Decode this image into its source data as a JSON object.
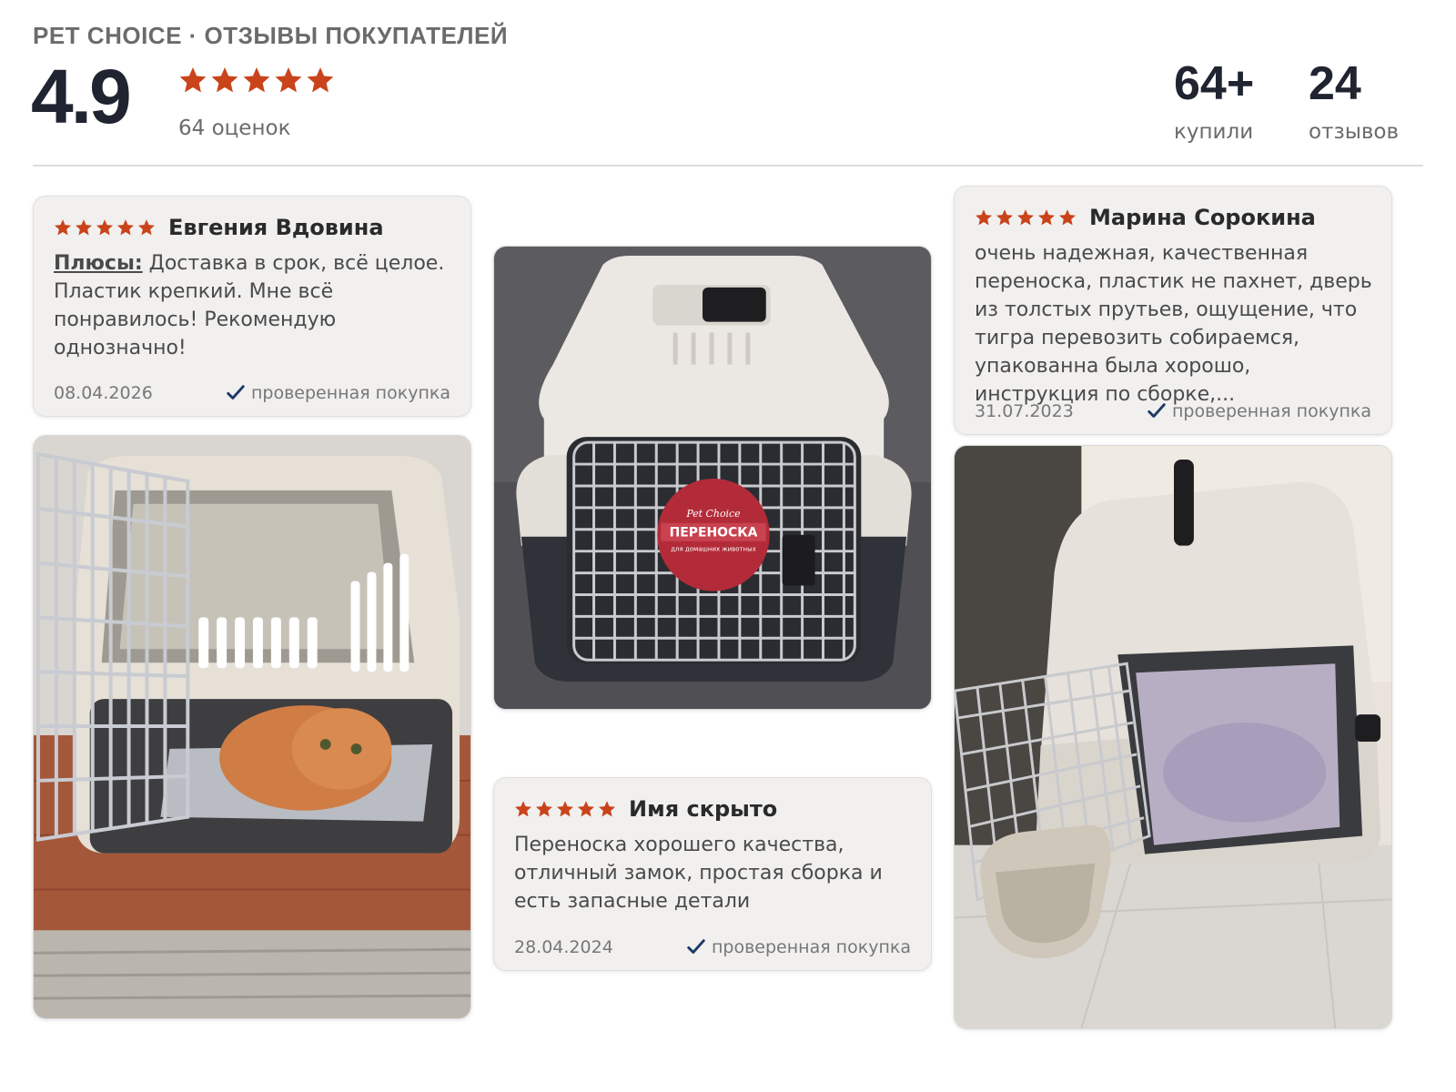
{
  "header": {
    "brand": "PET CHOICE · ОТЗЫВЫ ПОКУПАТЕЛЕЙ",
    "score": "4.9",
    "ratings_count": "64 оценок",
    "stats": [
      {
        "value": "64+",
        "label": "купили"
      },
      {
        "value": "24",
        "label": "отзывов"
      }
    ]
  },
  "colors": {
    "star": "#c9431b",
    "check": "#1e3a66",
    "card_bg": "#f1f0ef",
    "text_dark": "#1f2430"
  },
  "reviews": [
    {
      "author": "Евгения Вдовина",
      "rating": 5,
      "plus_label": "Плюсы:",
      "text": " Доставка в срок, всё целое. Пластик крепкий. Мне всё понравилось! Рекомендую однозначно!",
      "date": "08.04.2026",
      "verified": "проверенная покупка"
    },
    {
      "author": "Имя скрыто",
      "rating": 5,
      "text": "Переноска хорошего качества, отличный замок, простая сборка и есть запасные детали",
      "date": "28.04.2024",
      "verified": "проверенная покупка"
    },
    {
      "author": "Марина Сорокина",
      "rating": 5,
      "text": "очень надежная, качественная переноска, пластик не пахнет, дверь из толстых прутьев, ощущение, что тигра перевозить собираемся, упакованна была хорошо, инструкция по сборке,...",
      "date": "31.07.2023",
      "verified": "проверенная покупка"
    }
  ],
  "photos": [
    {
      "subject": "open-carrier-with-cat"
    },
    {
      "subject": "carrier-with-label",
      "label_brand": "Pet Choice",
      "label_title": "ПЕРЕНОСКА",
      "label_sub": "для домашних животных"
    },
    {
      "subject": "open-carrier-with-bowl"
    }
  ],
  "icons": {
    "star": "star-icon",
    "check": "check-icon"
  }
}
